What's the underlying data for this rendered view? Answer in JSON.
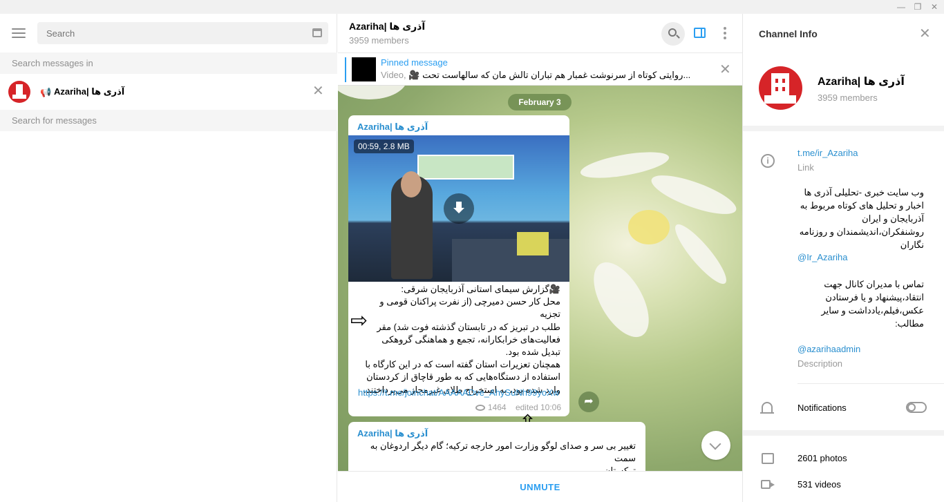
{
  "window": {
    "minimize": "—",
    "restore": "❐",
    "close": "✕"
  },
  "left": {
    "search_placeholder": "Search",
    "search_in_label": "Search messages in",
    "chat_name": "Azariha| آذری ها",
    "search_for_label": "Search for messages"
  },
  "chat": {
    "title": "Azariha| آذری ها",
    "members": "3959 members",
    "pinned": {
      "title": "Pinned message",
      "prefix": "Video, ",
      "text": "روایتی کوتاه از سرنوشت غمبار هم تباران تالش مان که سالهاست تحت..."
    },
    "date": "February 3",
    "message1": {
      "sender": "Azariha| آذری ها",
      "video_info": "00:59, 2.8 MB",
      "text_lines": [
        "🎥گزارش سیمای استانی آذربایجان شرقی:",
        "محل کار حسن دمیرچی (از نفرت پراکنان قومی و تجزیه",
        "طلب در تبریز که در تابستان گذشته فوت شد) مقر",
        "فعالیت‌های خرابکارانه، تجمع و هماهنگی گروهکی",
        "تبدیل شده بود.",
        "همچنان تعزیرات استان گفته است که در این کارگاه با",
        "استفاده از دستگاه‌هایی که به طور قاچاق از کردستان",
        "وارد شده بود، به استخراج طلای غیرمجاز می‌پرداختند."
      ],
      "link": "https://t.me/joinchat/AAAAADve_AhySuNh99yoXw",
      "views": "1464",
      "edited": "edited 10:06"
    },
    "message2": {
      "sender": "Azariha| آذری ها",
      "text_lines": [
        "تغییر بی سر و صدای لوگو وزارت امور خارجه ترکیه؛ گام دیگر اردوغان به سمت",
        "ترکستان"
      ]
    },
    "unmute": "UNMUTE"
  },
  "info": {
    "title": "Channel Info",
    "name": "Azariha| آذری ها",
    "members": "3959 members",
    "link": "t.me/ir_Azariha",
    "link_label": "Link",
    "desc_lines": [
      "وب سایت خبری -تحلیلی آذری ها",
      "اخبار و تحلیل های کوتاه مربوط به",
      "آذربایجان و ایران",
      "روشنفکران،اندیشمندان و روزنامه",
      "نگاران"
    ],
    "handle": "@Ir_Azariha",
    "contact_lines": [
      "تماس با مدیران کانال جهت",
      "انتقاد،پیشنهاد و یا فرستادن",
      "عکس،فیلم،یادداشت و سایر",
      "مطالب:"
    ],
    "admin": "@azarihaadmin",
    "description_label": "Description",
    "notifications": "Notifications",
    "notifications_on": false,
    "photos": "2601 photos",
    "videos": "531 videos"
  },
  "colors": {
    "accent": "#2a9ef1",
    "link": "#2a8fcf",
    "avatar": "#d62428"
  }
}
